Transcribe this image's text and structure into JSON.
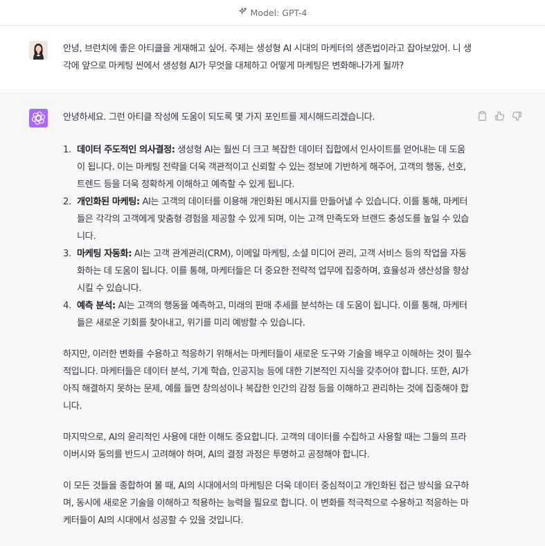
{
  "header": {
    "model_label": "Model: GPT-4"
  },
  "user_message": {
    "text": "안녕, 브런치에 좋은 아티클을 게재해고 싶어. 주제는 생성형 AI 시대의 마케터의 생존법이라고 잡아보았어. 니 생각에 앞으로 마케팅 씬에서 생성형 AI가 무엇을 대체하고 어떻게 마케팅은 변화해나가게 될까?"
  },
  "assistant_message": {
    "intro": "안녕하세요. 그런 아티클 작성에 도움이 되도록 몇 가지 포인트를 제시해드리겠습니다.",
    "points": [
      {
        "num": "1.",
        "title": "데이터 주도적인 의사결정:",
        "body": " 생성형 AI는 훨씬 더 크고 복잡한 데이터 집합에서 인사이트를 얻어내는 데 도움이 됩니다. 이는 마케팅 전략을 더욱 객관적이고 신뢰할 수 있는 정보에 기반하게 해주어, 고객의 행동, 선호, 트렌드 등을 더욱 정확하게 이해하고 예측할 수 있게 됩니다."
      },
      {
        "num": "2.",
        "title": "개인화된 마케팅:",
        "body": " AI는 고객의 데이터를 이용해 개인화된 메시지를 만들어낼 수 있습니다. 이를 통해, 마케터들은 각각의 고객에게 맞춤형 경험을 제공할 수 있게 되며, 이는 고객 만족도와 브랜드 충성도를 높일 수 있습니다."
      },
      {
        "num": "3.",
        "title": "마케팅 자동화:",
        "body": " AI는 고객 관계관리(CRM), 이메일 마케팅, 소셜 미디어 관리, 고객 서비스 등의 작업을 자동화하는 데 도움이 됩니다. 이를 통해, 마케터들은 더 중요한 전략적 업무에 집중하며, 효율성과 생산성을 향상시킬 수 있습니다."
      },
      {
        "num": "4.",
        "title": "예측 분석:",
        "body": " AI는 고객의 행동을 예측하고, 미래의 판매 추세를 분석하는 데 도움이 됩니다. 이를 통해, 마케터들은 새로운 기회를 찾아내고, 위기를 미리 예방할 수 있습니다."
      }
    ],
    "paragraphs": [
      "하지만, 이러한 변화를 수용하고 적응하기 위해서는 마케터들이 새로운 도구와 기술을 배우고 이해하는 것이 필수적입니다. 마케터들은 데이터 분석, 기계 학습, 인공지능 등에 대한 기본적인 지식을 갖추어야 합니다. 또한, AI가 아직 해결하지 못하는 문제, 예를 들면 창의성이나 복잡한 인간의 감정 등을 이해하고 관리하는 것에 집중해야 합니다.",
      "마지막으로, AI의 윤리적인 사용에 대한 이해도 중요합니다. 고객의 데이터를 수집하고 사용할 때는 그들의 프라이버시와 동의를 반드시 고려해야 하며, AI의 결정 과정은 투명하고 공정해야 합니다.",
      "이 모든 것들을 종합하여 볼 때, AI의 시대에서의 마케팅은 더욱 데이터 중심적이고 개인화된 접근 방식을 요구하며, 동시에 새로운 기술을 이해하고 적용하는 능력을 필요로 합니다. 이 변화를 적극적으로 수용하고 적응하는 마케터들이 AI의 시대에서 성공할 수 있을 것입니다."
    ]
  },
  "icons": {
    "model": "sparkle-icon",
    "assistant_avatar": "openai-logo-icon",
    "actions": [
      "clipboard-icon",
      "thumbs-up-icon",
      "thumbs-down-icon"
    ]
  },
  "colors": {
    "assistant_avatar_bg": "#ab68ff",
    "assistant_bg": "#f7f7f8",
    "text": "#343541"
  }
}
